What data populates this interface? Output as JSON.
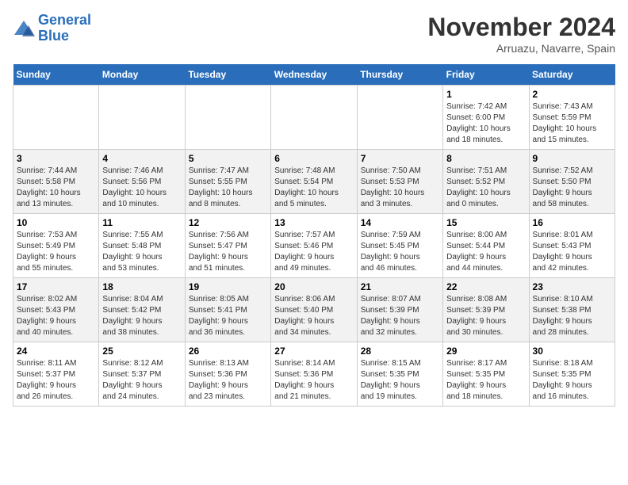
{
  "header": {
    "logo_line1": "General",
    "logo_line2": "Blue",
    "month_title": "November 2024",
    "location": "Arruazu, Navarre, Spain"
  },
  "weekdays": [
    "Sunday",
    "Monday",
    "Tuesday",
    "Wednesday",
    "Thursday",
    "Friday",
    "Saturday"
  ],
  "weeks": [
    [
      {
        "day": "",
        "info": ""
      },
      {
        "day": "",
        "info": ""
      },
      {
        "day": "",
        "info": ""
      },
      {
        "day": "",
        "info": ""
      },
      {
        "day": "",
        "info": ""
      },
      {
        "day": "1",
        "info": "Sunrise: 7:42 AM\nSunset: 6:00 PM\nDaylight: 10 hours\nand 18 minutes."
      },
      {
        "day": "2",
        "info": "Sunrise: 7:43 AM\nSunset: 5:59 PM\nDaylight: 10 hours\nand 15 minutes."
      }
    ],
    [
      {
        "day": "3",
        "info": "Sunrise: 7:44 AM\nSunset: 5:58 PM\nDaylight: 10 hours\nand 13 minutes."
      },
      {
        "day": "4",
        "info": "Sunrise: 7:46 AM\nSunset: 5:56 PM\nDaylight: 10 hours\nand 10 minutes."
      },
      {
        "day": "5",
        "info": "Sunrise: 7:47 AM\nSunset: 5:55 PM\nDaylight: 10 hours\nand 8 minutes."
      },
      {
        "day": "6",
        "info": "Sunrise: 7:48 AM\nSunset: 5:54 PM\nDaylight: 10 hours\nand 5 minutes."
      },
      {
        "day": "7",
        "info": "Sunrise: 7:50 AM\nSunset: 5:53 PM\nDaylight: 10 hours\nand 3 minutes."
      },
      {
        "day": "8",
        "info": "Sunrise: 7:51 AM\nSunset: 5:52 PM\nDaylight: 10 hours\nand 0 minutes."
      },
      {
        "day": "9",
        "info": "Sunrise: 7:52 AM\nSunset: 5:50 PM\nDaylight: 9 hours\nand 58 minutes."
      }
    ],
    [
      {
        "day": "10",
        "info": "Sunrise: 7:53 AM\nSunset: 5:49 PM\nDaylight: 9 hours\nand 55 minutes."
      },
      {
        "day": "11",
        "info": "Sunrise: 7:55 AM\nSunset: 5:48 PM\nDaylight: 9 hours\nand 53 minutes."
      },
      {
        "day": "12",
        "info": "Sunrise: 7:56 AM\nSunset: 5:47 PM\nDaylight: 9 hours\nand 51 minutes."
      },
      {
        "day": "13",
        "info": "Sunrise: 7:57 AM\nSunset: 5:46 PM\nDaylight: 9 hours\nand 49 minutes."
      },
      {
        "day": "14",
        "info": "Sunrise: 7:59 AM\nSunset: 5:45 PM\nDaylight: 9 hours\nand 46 minutes."
      },
      {
        "day": "15",
        "info": "Sunrise: 8:00 AM\nSunset: 5:44 PM\nDaylight: 9 hours\nand 44 minutes."
      },
      {
        "day": "16",
        "info": "Sunrise: 8:01 AM\nSunset: 5:43 PM\nDaylight: 9 hours\nand 42 minutes."
      }
    ],
    [
      {
        "day": "17",
        "info": "Sunrise: 8:02 AM\nSunset: 5:43 PM\nDaylight: 9 hours\nand 40 minutes."
      },
      {
        "day": "18",
        "info": "Sunrise: 8:04 AM\nSunset: 5:42 PM\nDaylight: 9 hours\nand 38 minutes."
      },
      {
        "day": "19",
        "info": "Sunrise: 8:05 AM\nSunset: 5:41 PM\nDaylight: 9 hours\nand 36 minutes."
      },
      {
        "day": "20",
        "info": "Sunrise: 8:06 AM\nSunset: 5:40 PM\nDaylight: 9 hours\nand 34 minutes."
      },
      {
        "day": "21",
        "info": "Sunrise: 8:07 AM\nSunset: 5:39 PM\nDaylight: 9 hours\nand 32 minutes."
      },
      {
        "day": "22",
        "info": "Sunrise: 8:08 AM\nSunset: 5:39 PM\nDaylight: 9 hours\nand 30 minutes."
      },
      {
        "day": "23",
        "info": "Sunrise: 8:10 AM\nSunset: 5:38 PM\nDaylight: 9 hours\nand 28 minutes."
      }
    ],
    [
      {
        "day": "24",
        "info": "Sunrise: 8:11 AM\nSunset: 5:37 PM\nDaylight: 9 hours\nand 26 minutes."
      },
      {
        "day": "25",
        "info": "Sunrise: 8:12 AM\nSunset: 5:37 PM\nDaylight: 9 hours\nand 24 minutes."
      },
      {
        "day": "26",
        "info": "Sunrise: 8:13 AM\nSunset: 5:36 PM\nDaylight: 9 hours\nand 23 minutes."
      },
      {
        "day": "27",
        "info": "Sunrise: 8:14 AM\nSunset: 5:36 PM\nDaylight: 9 hours\nand 21 minutes."
      },
      {
        "day": "28",
        "info": "Sunrise: 8:15 AM\nSunset: 5:35 PM\nDaylight: 9 hours\nand 19 minutes."
      },
      {
        "day": "29",
        "info": "Sunrise: 8:17 AM\nSunset: 5:35 PM\nDaylight: 9 hours\nand 18 minutes."
      },
      {
        "day": "30",
        "info": "Sunrise: 8:18 AM\nSunset: 5:35 PM\nDaylight: 9 hours\nand 16 minutes."
      }
    ]
  ]
}
